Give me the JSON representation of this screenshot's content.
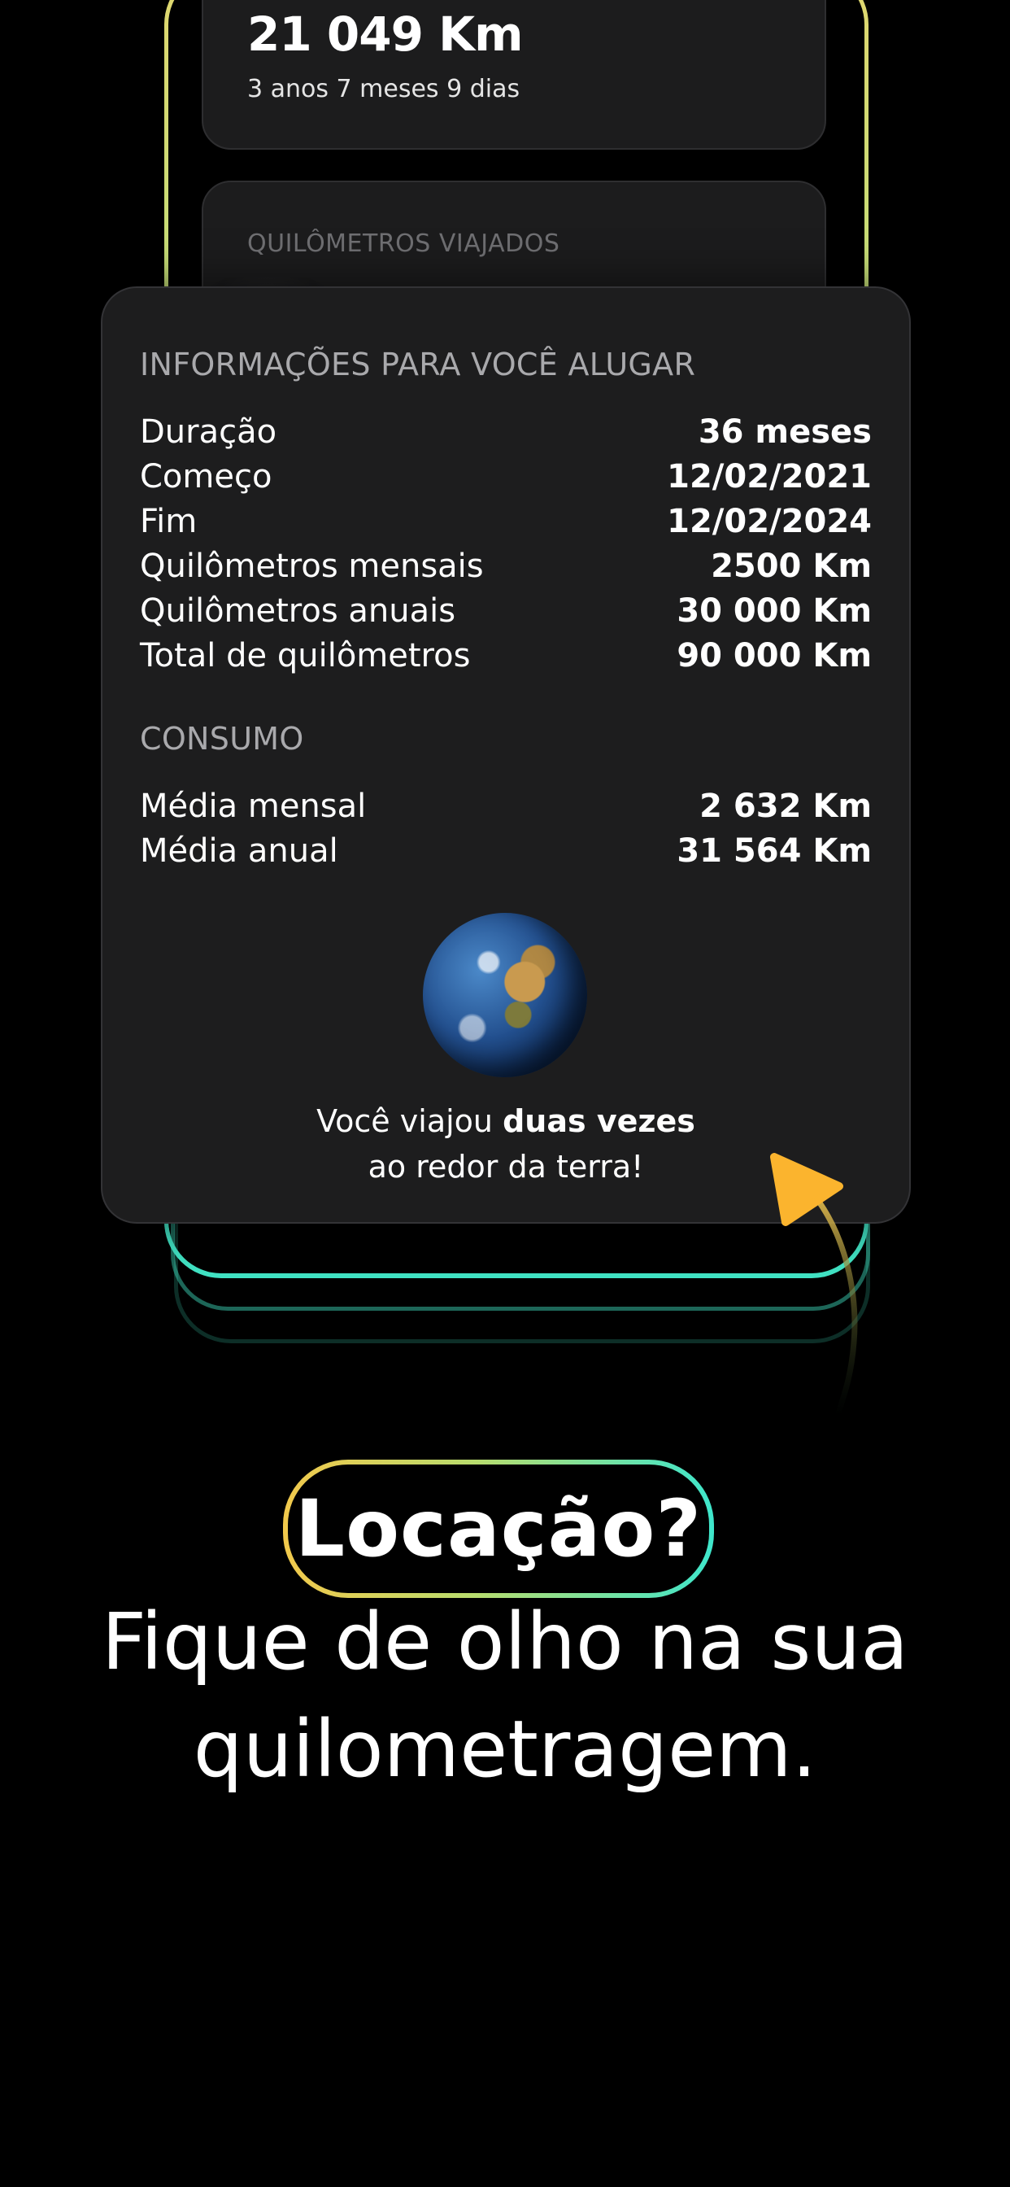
{
  "background": {
    "km_card": {
      "value": "21 049 Km",
      "sub": "3 anos 7 meses 9 dias"
    },
    "viajados_label": "QUILÔMETROS VIAJADOS"
  },
  "info": {
    "title": "INFORMAÇÕES PARA VOCÊ ALUGAR",
    "rows": [
      {
        "label": "Duração",
        "value": "36 meses"
      },
      {
        "label": "Começo",
        "value": "12/02/2021"
      },
      {
        "label": "Fim",
        "value": "12/02/2024"
      },
      {
        "label": "Quilômetros mensais",
        "value": "2500 Km"
      },
      {
        "label": "Quilômetros anuais",
        "value": "30 000 Km"
      },
      {
        "label": "Total de quilômetros",
        "value": "90 000 Km"
      }
    ],
    "consumo_title": "CONSUMO",
    "consumo_rows": [
      {
        "label": "Média mensal",
        "value": "2 632 Km"
      },
      {
        "label": "Média anual",
        "value": "31 564 Km"
      }
    ],
    "travel_prefix": "Você viajou ",
    "travel_bold": "duas vezes",
    "travel_suffix": "ao redor da terra!"
  },
  "headline": {
    "pill": "Locação?",
    "line1": "Fique de olho na sua",
    "line2": "quilometragem."
  },
  "colors": {
    "accent_teal": "#41e3c4",
    "accent_yellow": "#f2c94c",
    "arrow": "#fbb42e"
  },
  "icons": {
    "globe": "earth-globe-icon",
    "arrow": "curved-arrow-icon"
  }
}
